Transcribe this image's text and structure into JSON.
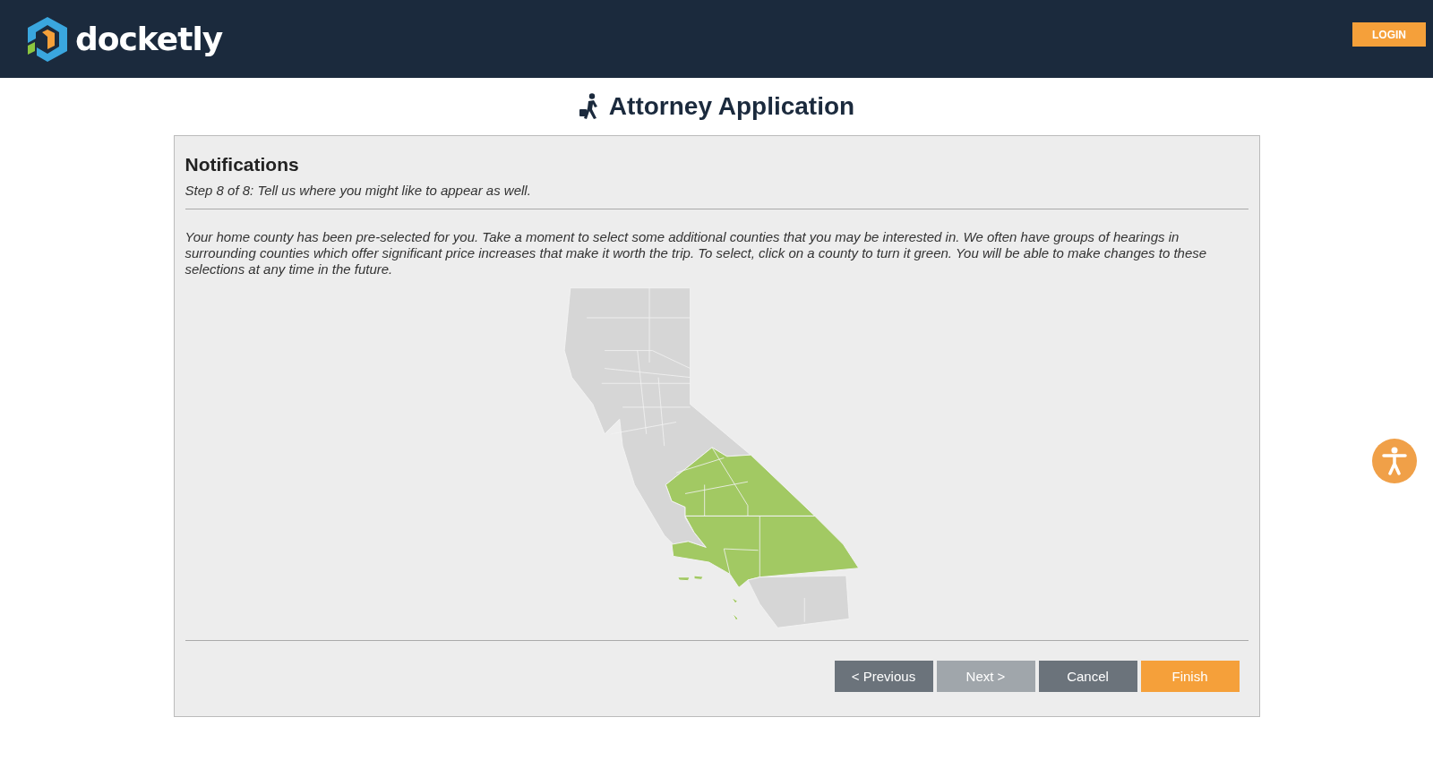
{
  "header": {
    "logo_text": "docketly",
    "login_button": "LOGIN"
  },
  "page_title": "Attorney Application",
  "step": {
    "heading": "Notifications",
    "subtitle": "Step 8 of 8: Tell us where you might like to appear as well.",
    "description": "Your home county has been pre-selected for you. Take a moment to select some additional counties that you may be interested in. We often have groups of hearings in surrounding counties which offer significant price increases that make it worth the trip. To select, click on a county to turn it green. You will be able to make changes to these selections at any time in the future."
  },
  "map": {
    "regions": [
      {
        "selected": false
      },
      {
        "selected": true
      },
      {
        "selected": true
      },
      {
        "selected": false
      },
      {
        "selected": true
      }
    ]
  },
  "buttons": [
    {
      "label": "< Previous",
      "disabled": false,
      "kind": "secondary"
    },
    {
      "label": "Next >",
      "disabled": true,
      "kind": "secondary"
    },
    {
      "label": "Cancel",
      "disabled": false,
      "kind": "secondary"
    },
    {
      "label": "Finish",
      "disabled": false,
      "kind": "primary"
    }
  ]
}
